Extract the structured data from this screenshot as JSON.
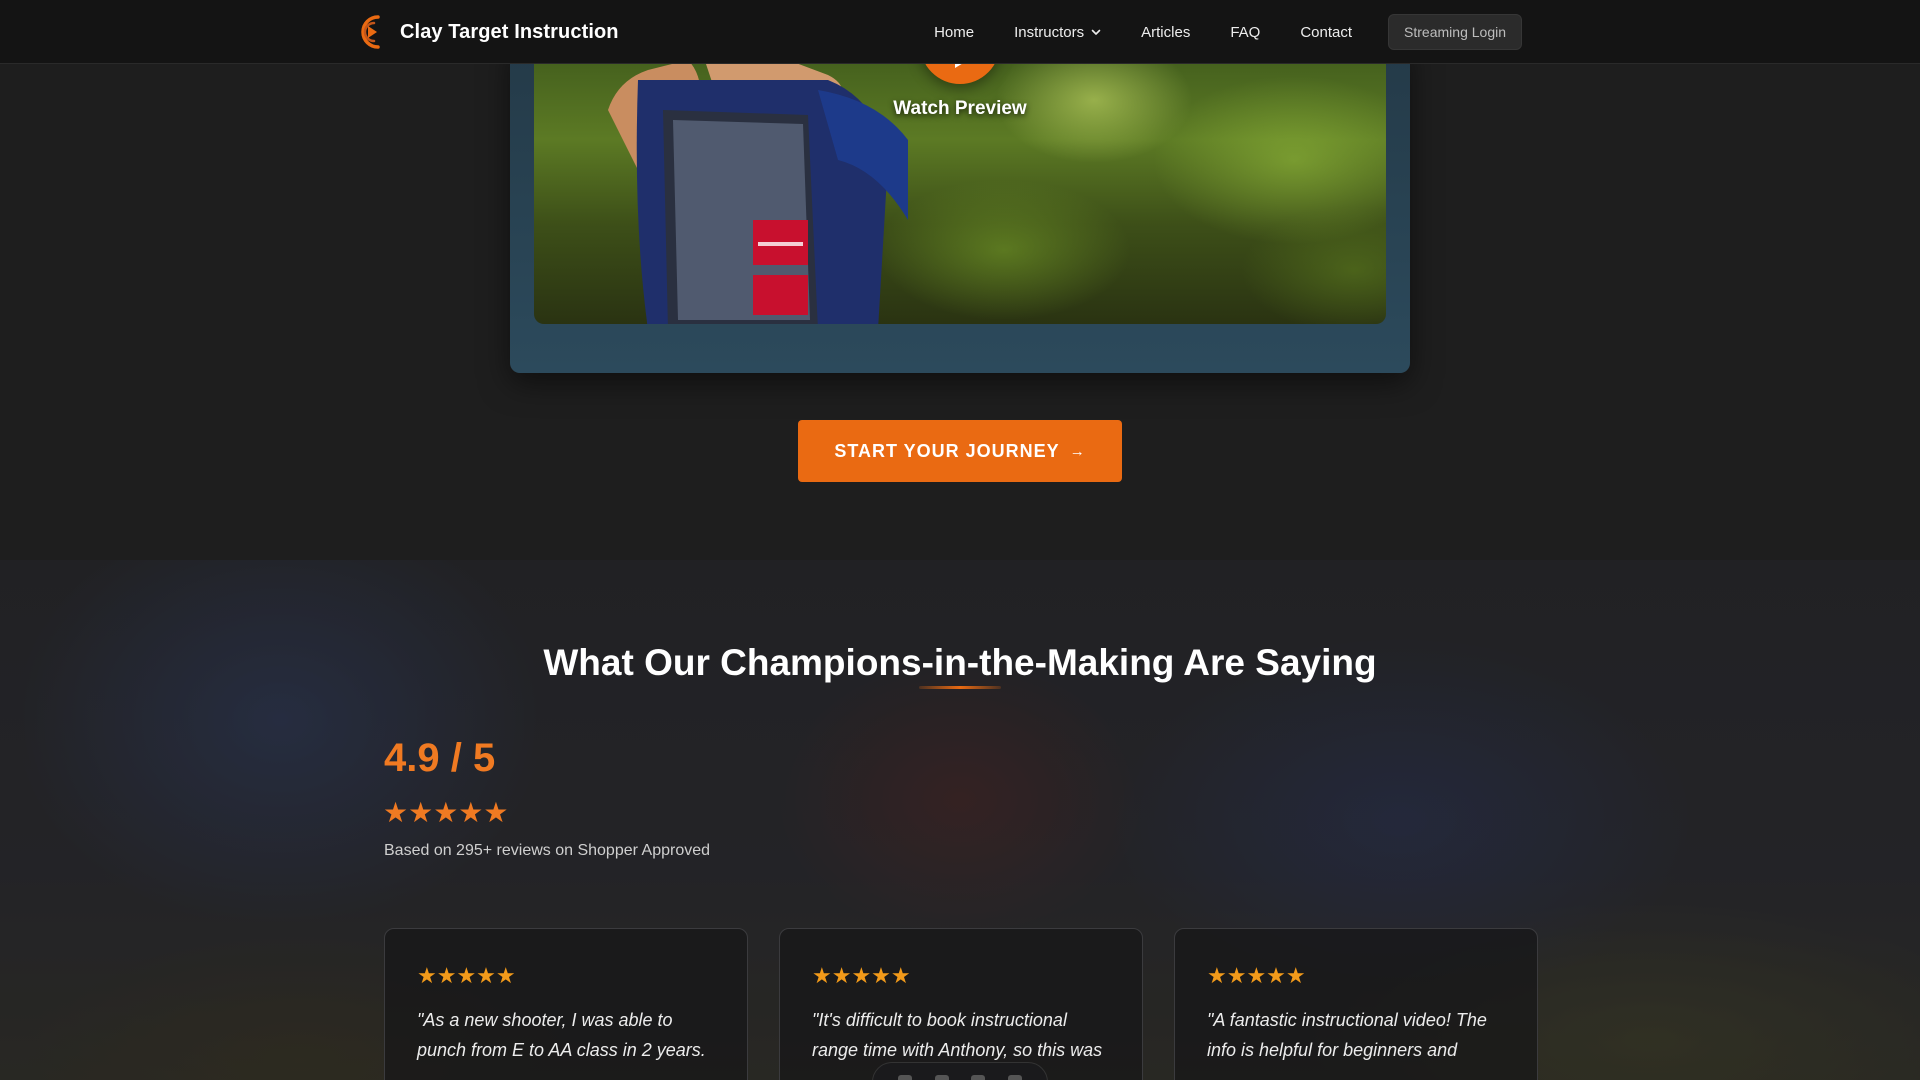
{
  "nav": {
    "brand": "Clay Target Instruction",
    "links": [
      {
        "label": "Home"
      },
      {
        "label": "Instructors",
        "has_dropdown": true
      },
      {
        "label": "Articles"
      },
      {
        "label": "FAQ"
      },
      {
        "label": "Contact"
      }
    ],
    "login_label": "Streaming Login"
  },
  "video": {
    "watch_label": "Watch Preview",
    "play_icon": "play-icon"
  },
  "cta": {
    "label": "START YOUR JOURNEY",
    "arrow": "→"
  },
  "testimonials": {
    "title": "What Our Champions-in-the-Making Are Saying",
    "rating": {
      "score": "4.9 / 5",
      "stars": "★★★★★",
      "note": "Based on 295+ reviews on Shopper Approved"
    },
    "cards": [
      {
        "stars": "★★★★★",
        "quote": "\"As a new shooter, I was able to punch from E to AA class in 2 years."
      },
      {
        "stars": "★★★★★",
        "quote": "\"It's difficult to book instructional range time with Anthony, so this was"
      },
      {
        "stars": "★★★★★",
        "quote": "\"A fantastic instructional video! The info is helpful for beginners and"
      }
    ]
  },
  "colors": {
    "accent": "#ea6a12",
    "star": "#f29a1a",
    "nav_bg": "#141414",
    "page_bg": "#1e1e1e"
  }
}
